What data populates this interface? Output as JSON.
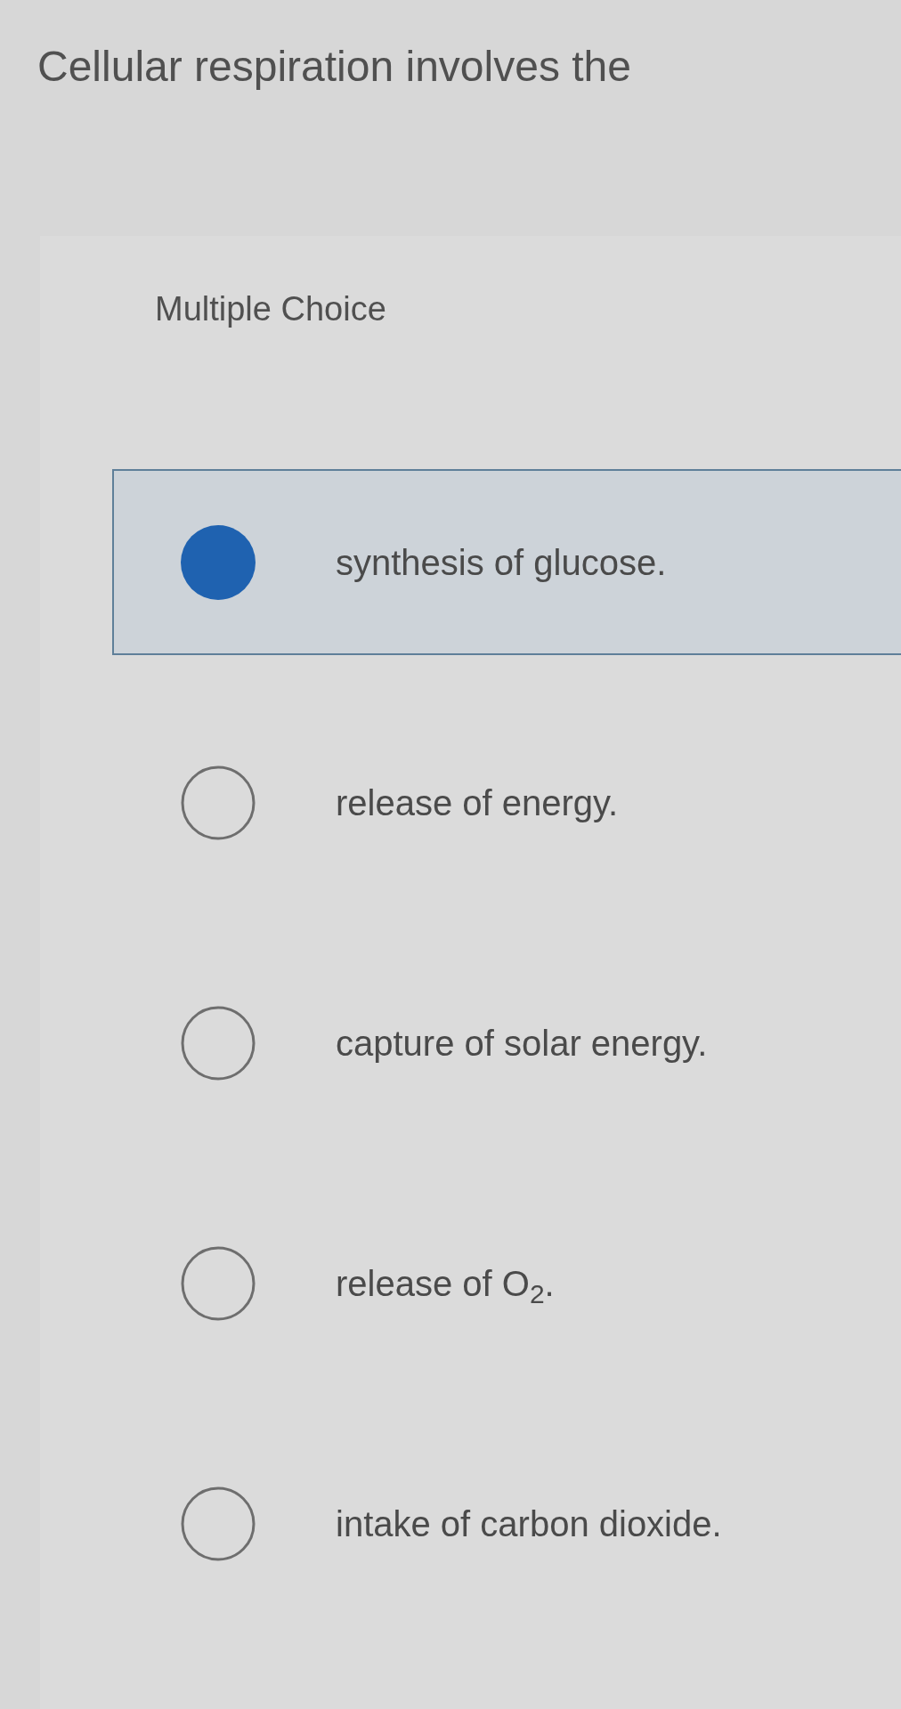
{
  "question": {
    "prompt": "Cellular respiration involves the"
  },
  "panel": {
    "label": "Multiple Choice",
    "options": [
      {
        "text": "synthesis of glucose.",
        "selected": true
      },
      {
        "text": "release of energy.",
        "selected": false
      },
      {
        "text": "capture of solar energy.",
        "selected": false
      },
      {
        "text": "release of O$_{2}$.",
        "selected": false
      },
      {
        "text": "intake of carbon dioxide.",
        "selected": false
      }
    ]
  }
}
